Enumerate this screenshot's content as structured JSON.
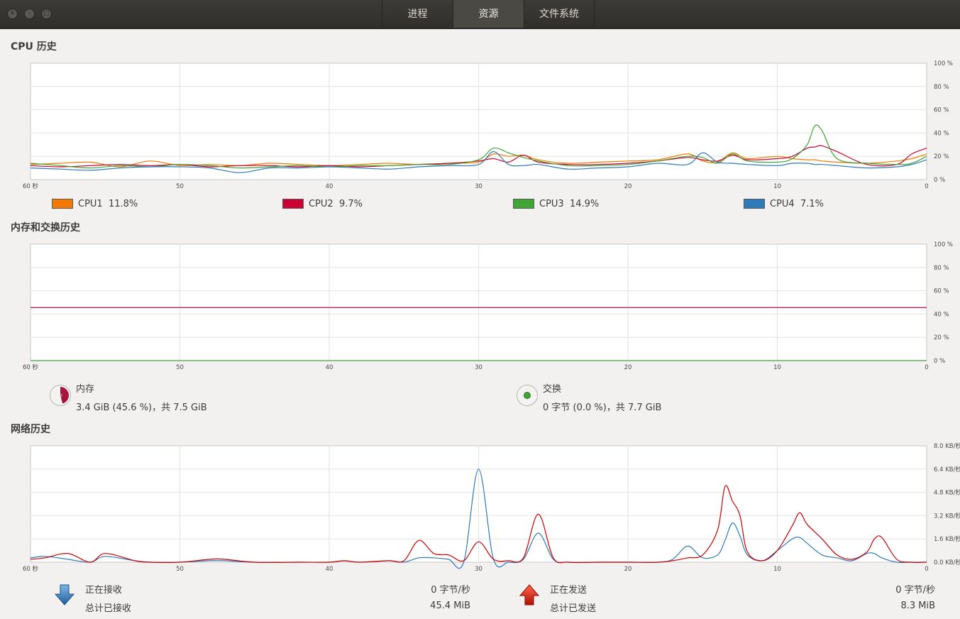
{
  "window": {
    "tabs": [
      {
        "label": "进程",
        "active": false
      },
      {
        "label": "资源",
        "active": true
      },
      {
        "label": "文件系统",
        "active": false
      }
    ]
  },
  "cpu": {
    "title": "CPU 历史",
    "x_ticks": [
      "60 秒",
      "50",
      "40",
      "30",
      "20",
      "10",
      "0"
    ],
    "y_ticks": [
      "100 %",
      "80 %",
      "60 %",
      "40 %",
      "20 %",
      "0 %"
    ],
    "legend": [
      {
        "label": "CPU1",
        "value": "11.8%",
        "color": "#f57900"
      },
      {
        "label": "CPU2",
        "value": "9.7%",
        "color": "#cc0033"
      },
      {
        "label": "CPU3",
        "value": "14.9%",
        "color": "#3fa535"
      },
      {
        "label": "CPU4",
        "value": "7.1%",
        "color": "#2f7ab9"
      }
    ]
  },
  "memory": {
    "title": "内存和交换历史",
    "x_ticks": [
      "60 秒",
      "50",
      "40",
      "30",
      "20",
      "10",
      "0"
    ],
    "y_ticks": [
      "100 %",
      "80 %",
      "60 %",
      "40 %",
      "20 %",
      "0 %"
    ],
    "mem": {
      "label": "内存",
      "detail": "3.4 GiB (45.6 %)，共 7.5 GiB",
      "color": "#a8123e",
      "fraction": 0.456
    },
    "swap": {
      "label": "交换",
      "detail": "0 字节 (0.0 %)，共 7.7 GiB",
      "color": "#3fa535",
      "fraction": 0.0
    }
  },
  "network": {
    "title": "网络历史",
    "x_ticks": [
      "60 秒",
      "50",
      "40",
      "30",
      "20",
      "10",
      "0"
    ],
    "y_ticks": [
      "8.0 KB/秒",
      "6.4 KB/秒",
      "4.8 KB/秒",
      "3.2 KB/秒",
      "1.6 KB/秒",
      "0.0 KB/秒"
    ],
    "receiving": {
      "label": "正在接收",
      "rate": "0 字节/秒",
      "total_label": "总计已接收",
      "total": "45.4 MiB",
      "color": "#2f7ab9"
    },
    "sending": {
      "label": "正在发送",
      "rate": "0 字节/秒",
      "total_label": "总计已发送",
      "total": "8.3 MiB",
      "color": "#cc0000"
    }
  },
  "chart_data": [
    {
      "type": "line",
      "title": "CPU 历史",
      "xlabel": "秒",
      "ylabel": "%",
      "xlim": [
        60,
        0
      ],
      "ylim": [
        0,
        100
      ],
      "x": [
        60,
        58,
        56,
        54,
        52,
        50,
        48,
        46,
        44,
        42,
        40,
        38,
        36,
        34,
        32,
        30,
        29,
        28,
        27,
        26,
        24,
        22,
        20,
        18,
        16,
        15,
        14,
        13,
        12,
        10,
        9,
        8,
        7.5,
        7,
        6,
        4,
        2,
        1,
        0
      ],
      "series": [
        {
          "name": "CPU1",
          "values": [
            13,
            14,
            15,
            11,
            16,
            12,
            13,
            12,
            14,
            13,
            12,
            13,
            14,
            13,
            14,
            15,
            22,
            20,
            21,
            17,
            14,
            15,
            16,
            17,
            22,
            16,
            15,
            23,
            18,
            20,
            18,
            17,
            17,
            16,
            15,
            14,
            16,
            18,
            22
          ]
        },
        {
          "name": "CPU2",
          "values": [
            12,
            11,
            12,
            13,
            12,
            13,
            11,
            12,
            12,
            11,
            12,
            11,
            12,
            13,
            14,
            16,
            18,
            15,
            21,
            15,
            13,
            13,
            14,
            16,
            19,
            17,
            16,
            21,
            17,
            18,
            20,
            27,
            28,
            29,
            24,
            13,
            13,
            22,
            27
          ]
        },
        {
          "name": "CPU3",
          "values": [
            14,
            12,
            10,
            12,
            11,
            13,
            12,
            10,
            11,
            12,
            11,
            12,
            12,
            13,
            13,
            17,
            27,
            23,
            19,
            16,
            12,
            12,
            13,
            16,
            20,
            19,
            14,
            22,
            16,
            15,
            18,
            30,
            46,
            42,
            18,
            14,
            13,
            14,
            20
          ]
        },
        {
          "name": "CPU4",
          "values": [
            10,
            9,
            8,
            10,
            11,
            11,
            10,
            6,
            10,
            10,
            11,
            10,
            9,
            11,
            12,
            13,
            24,
            13,
            12,
            13,
            9,
            10,
            11,
            14,
            13,
            23,
            15,
            14,
            13,
            12,
            14,
            14,
            13,
            13,
            12,
            10,
            11,
            13,
            17
          ]
        }
      ]
    },
    {
      "type": "line",
      "title": "内存和交换历史",
      "xlabel": "秒",
      "ylabel": "%",
      "xlim": [
        60,
        0
      ],
      "ylim": [
        0,
        100
      ],
      "x": [
        60,
        0
      ],
      "series": [
        {
          "name": "内存",
          "values": [
            45.6,
            45.6
          ]
        },
        {
          "name": "交换",
          "values": [
            0,
            0
          ]
        }
      ]
    },
    {
      "type": "line",
      "title": "网络历史",
      "xlabel": "秒",
      "ylabel": "KB/秒",
      "xlim": [
        60,
        0
      ],
      "ylim": [
        0,
        8.0
      ],
      "x": [
        60,
        59,
        57.5,
        56,
        55,
        53,
        52,
        50,
        48,
        47,
        45,
        42,
        40,
        39,
        38,
        36,
        35,
        34,
        33,
        32,
        31,
        30,
        29,
        28,
        27,
        26,
        25,
        24,
        22,
        20,
        18,
        17,
        16,
        15,
        14,
        13.5,
        13,
        12.5,
        12,
        11,
        10,
        9,
        8.5,
        8,
        7,
        6,
        5,
        4,
        3.5,
        3,
        2,
        1,
        0
      ],
      "series": [
        {
          "name": "正在接收",
          "values": [
            0.3,
            0.4,
            0.2,
            0,
            0.4,
            0.1,
            0,
            0,
            0.1,
            0.1,
            0,
            0,
            0,
            0.1,
            0,
            0.1,
            0,
            0.3,
            0.3,
            0.2,
            0,
            6.4,
            0.2,
            0,
            0.2,
            2.0,
            0.2,
            0,
            0,
            0,
            0,
            0.2,
            1.1,
            0.3,
            0.5,
            1.5,
            2.7,
            1.8,
            0.5,
            0.1,
            0.8,
            1.6,
            1.7,
            1.3,
            0.5,
            0.3,
            0.1,
            0.6,
            0.6,
            0.3,
            0,
            0,
            0
          ]
        },
        {
          "name": "正在发送",
          "values": [
            0.2,
            0.3,
            0.6,
            0,
            0.6,
            0.1,
            0,
            0,
            0.2,
            0.2,
            0,
            0,
            0,
            0.1,
            0,
            0.1,
            0.1,
            1.5,
            0.6,
            0.5,
            0.1,
            1.4,
            0.2,
            0.1,
            0.3,
            3.3,
            0.3,
            0,
            0,
            0,
            0,
            0.1,
            0.3,
            0.5,
            2.2,
            5.2,
            4.2,
            3.2,
            0.7,
            0.1,
            0.8,
            2.5,
            3.4,
            2.6,
            1.6,
            0.5,
            0.2,
            0.7,
            1.6,
            1.7,
            0.2,
            0,
            0
          ]
        }
      ]
    }
  ]
}
